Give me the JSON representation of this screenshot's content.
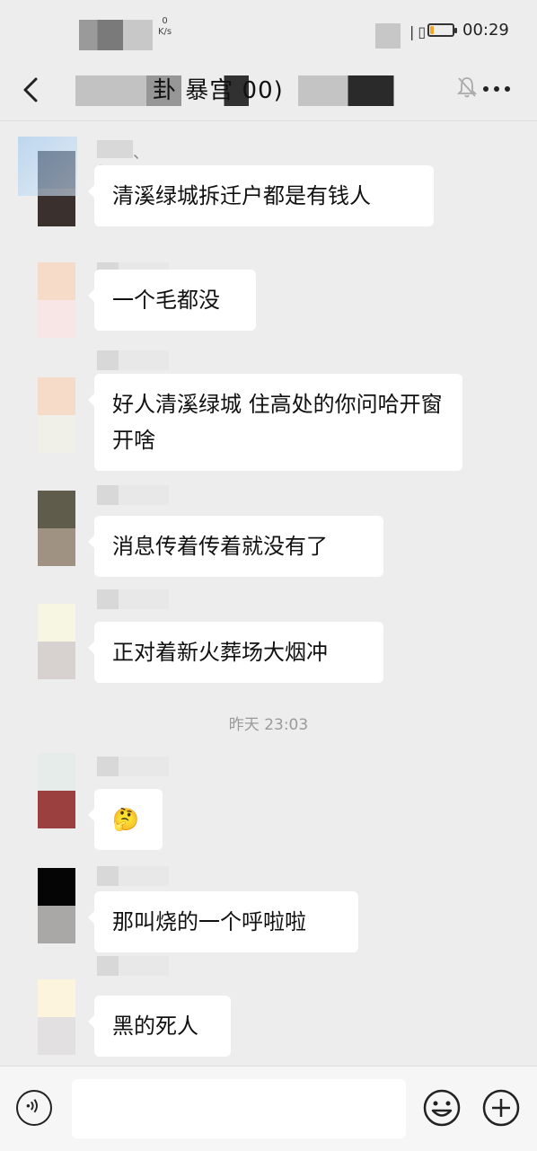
{
  "status_bar": {
    "speed_value": "0",
    "speed_unit": "K/s",
    "time": "00:29",
    "battery_level": 0.18,
    "battery_color": "#f5a623"
  },
  "header": {
    "title_visible": "卦      暴宫      00)",
    "back_icon": "chevron-left-icon",
    "mute_icon": "bell-off-icon",
    "more_icon": "ellipsis-icon"
  },
  "messages": [
    {
      "sender_suffix": "、🍉",
      "text": "清溪绿城拆迁户都是有钱人"
    },
    {
      "sender_suffix": "",
      "text": "一个毛都没"
    },
    {
      "sender_suffix": "",
      "text": "好人清溪绿城 住高处的你问哈开窗开啥"
    },
    {
      "sender_suffix": "",
      "text": "消息传着传着就没有了"
    },
    {
      "sender_suffix": "",
      "text": "正对着新火葬场大烟冲"
    },
    {
      "sender_suffix": "",
      "text": "🤔"
    },
    {
      "sender_suffix": "",
      "text": "那叫烧的一个呼啦啦"
    },
    {
      "sender_suffix": "",
      "text": "黑的死人"
    }
  ],
  "timestamp": "昨天 23:03",
  "input_bar": {
    "placeholder": "",
    "voice_icon": "voice-icon",
    "emoji_icon": "smiley-icon",
    "add_icon": "plus-icon"
  }
}
